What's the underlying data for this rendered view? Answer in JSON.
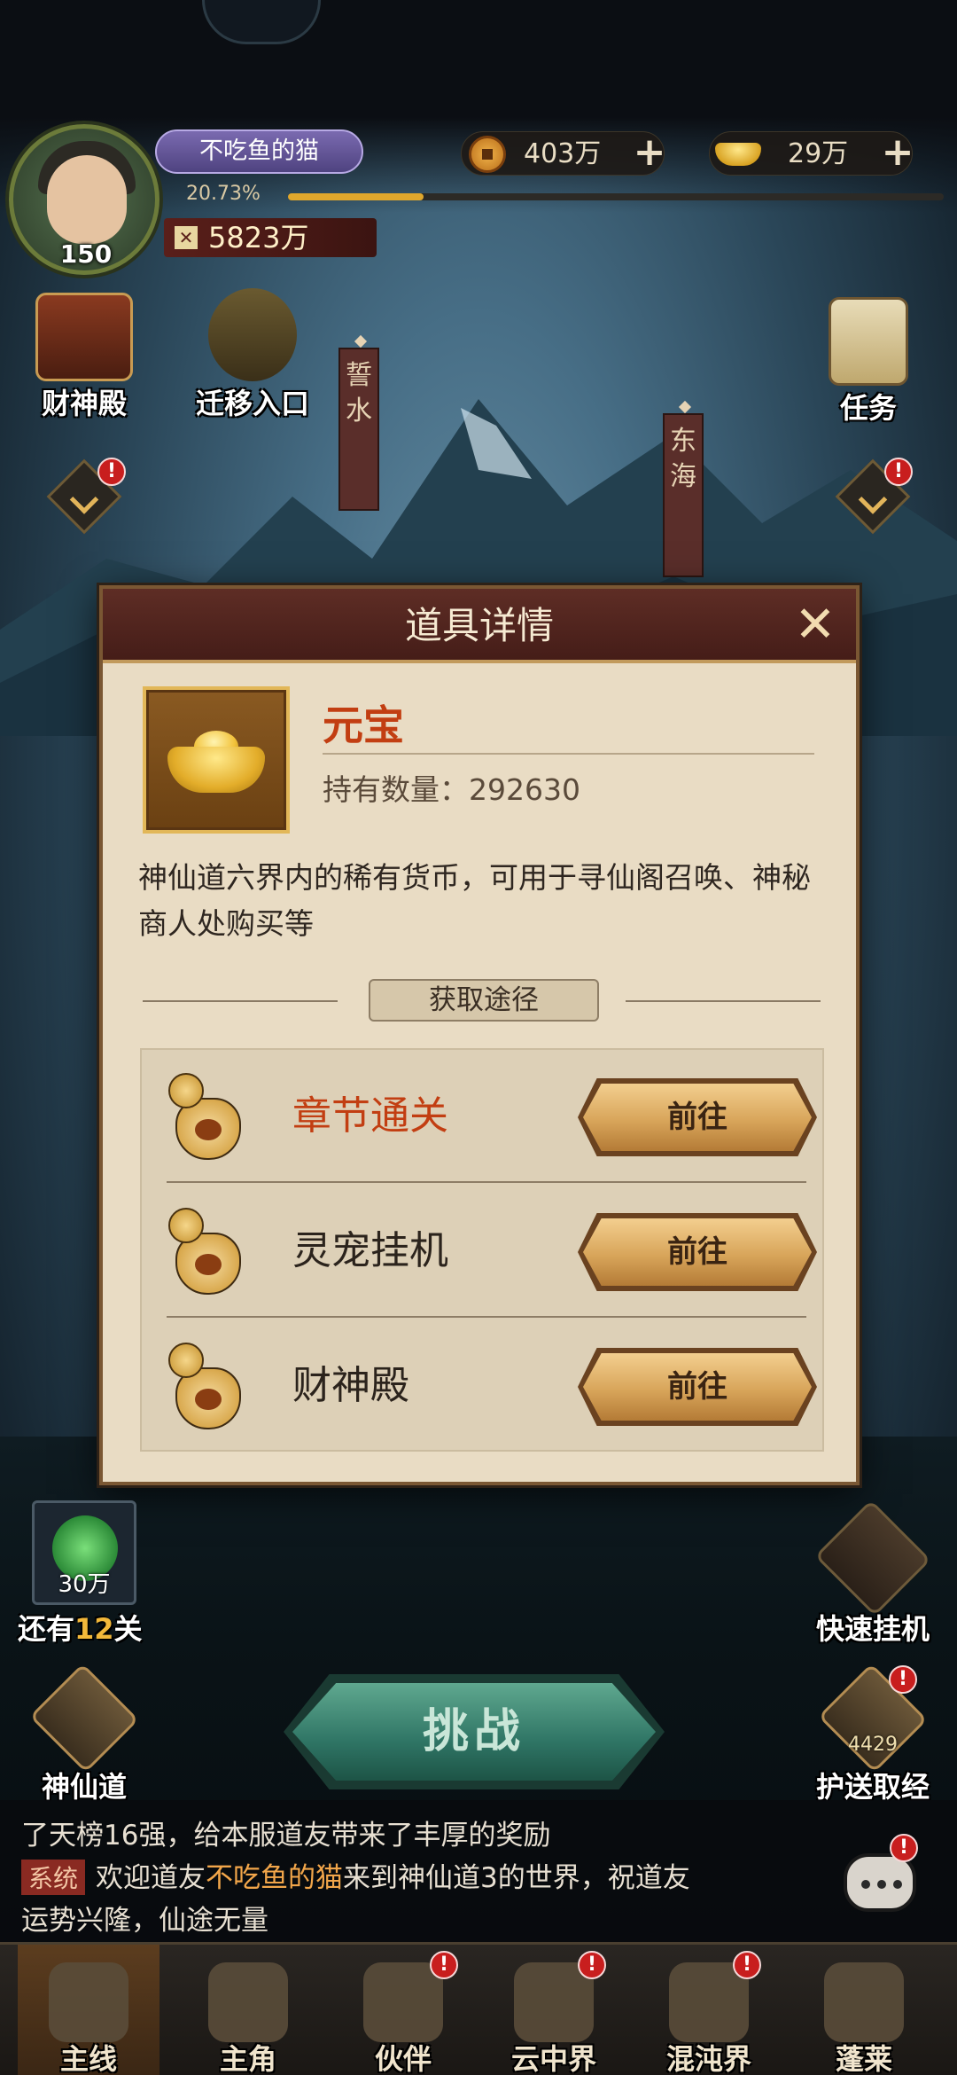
{
  "player": {
    "name": "不吃鱼的猫",
    "level": "150",
    "exp_percent_text": "20.73%",
    "exp_fraction": 0.2073,
    "power": "5823万"
  },
  "currencies": {
    "coins": "403万",
    "ingots": "29万"
  },
  "side_buttons": {
    "caishen": "财神殿",
    "migrate": "迁移入口",
    "task": "任务",
    "fast_idle": "快速挂机",
    "escort": "护送取经",
    "escort_count": "4429",
    "shenxian": "神仙道"
  },
  "banners": {
    "left": "誓水",
    "right": "东海"
  },
  "badges": {
    "mark": "!"
  },
  "modal": {
    "title": "道具详情",
    "close": "✕",
    "item_name": "元宝",
    "item_count": "持有数量：292630",
    "description": "神仙道六界内的稀有货币，可用于寻仙阁召唤、神秘商人处购买等",
    "paths_title": "获取途径",
    "paths": [
      {
        "name": "章节通关",
        "button": "前往"
      },
      {
        "name": "灵宠挂机",
        "button": "前往"
      },
      {
        "name": "财神殿",
        "button": "前往"
      }
    ]
  },
  "stage": {
    "reward": "30万",
    "remain_prefix": "还有",
    "remain_num": "12",
    "remain_suffix": "关"
  },
  "challenge_label": "挑战",
  "chat": {
    "line1": "了天榜16强，给本服道友带来了丰厚的奖励",
    "sys_tag": "系统",
    "line2_a": "欢迎道友",
    "line2_name": "不吃鱼的猫",
    "line2_b": "来到神仙道3的世界，祝道友",
    "line3": "运势兴隆，仙途无量"
  },
  "nav": {
    "items": [
      "主线",
      "主角",
      "伙伴",
      "云中界",
      "混沌界",
      "蓬莱"
    ]
  },
  "colors": {
    "accent_red": "#c23e12",
    "gold": "#e0a72c",
    "modal_bg": "#e9dcc4"
  }
}
